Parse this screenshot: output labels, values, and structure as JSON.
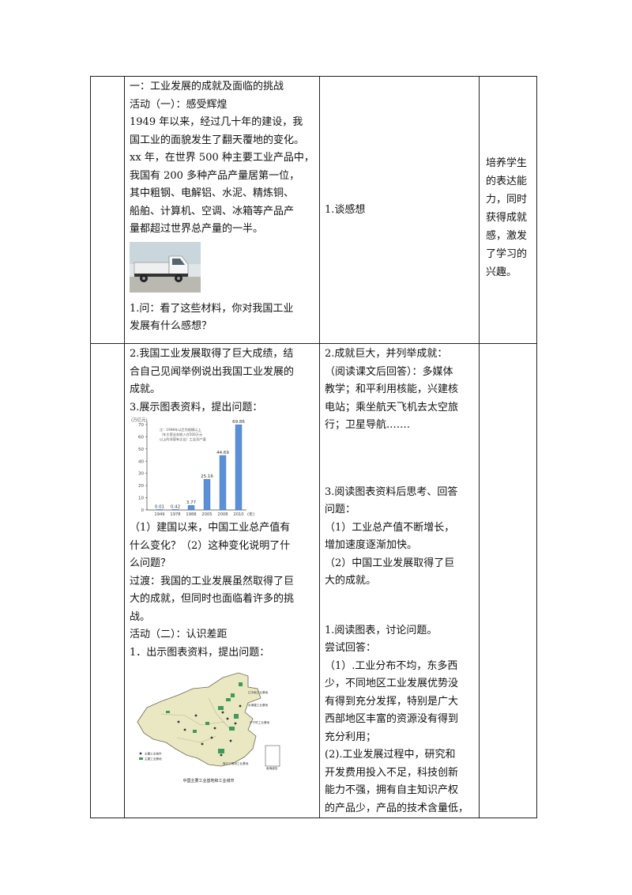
{
  "row1": {
    "col2": [
      "一：工业发展的成就及面临的挑战",
      "活动（一）：感受辉煌",
      "1949 年以来，经过几十年的建设，我",
      "国工业的面貌发生了翻天覆地的变化。",
      "xx 年，在世界 500 种主要工业产品中，",
      "我国有 200 多种产品产量居第一位，",
      "其中粗钢、电解铝、水泥、精炼铜、",
      "船舶、计算机、空调、冰箱等产品产",
      "量都超过世界总产量的一半。"
    ],
    "question": [
      "1.问：看了这些材料，你对我国工业",
      "发展有什么感想？"
    ],
    "student": "1.谈感想",
    "purpose": [
      "培养学生",
      "的表达能",
      "力，同时",
      "获得成就",
      "感，激发",
      "了学习的",
      "兴趣。"
    ]
  },
  "row2": {
    "col2_a": [
      "2.我国工业发展取得了巨大成绩，结",
      "合自己见闻举例说出我国工业发展的",
      "成就。",
      "3.展示图表资料，提出问题："
    ],
    "col2_b": [
      "（1）建国以来，中国工业总产值有",
      "什么变化？（2）这种变化说明了什",
      "么问题？",
      "过渡：我国的工业发展虽然取得了巨",
      "大的成就，但同时也面临着许多的挑",
      "战。",
      "活动（二）：认识差距",
      "1．出示图表资料，提出问题："
    ],
    "col3_a": [
      "2.成就巨大，并列举成就：",
      "（阅读课文后回答）：多媒体",
      "教学；和平利用核能，兴建核",
      "电站；乘坐航天飞机去太空旅",
      "行；卫星导航.……"
    ],
    "col3_b": [
      "3.阅读图表资料后思考、回答",
      "问题：",
      "（1）工业总产值不断增长，",
      "增加速度逐渐加快。",
      "（2）中国工业发展取得了巨",
      "大的成就。"
    ],
    "col3_c": [
      "1.阅读图表，讨论问题。",
      "尝试回答：",
      "（1）.工业分布不均，东多西",
      "少，不同地区工业发展优势没",
      "有得到充分发挥，特别是广大",
      "西部地区丰富的资源没有得到",
      "充分利用；",
      "(2).工业发展过程中，研究和",
      "开发费用投入不足，科技创新",
      "能力不强，拥有自主知识产权",
      "的产品少，产品的技术含量低，"
    ]
  },
  "chart_data": {
    "type": "bar",
    "categories": [
      "1949",
      "1978",
      "1988",
      "2005",
      "2008",
      "2010"
    ],
    "values": [
      0.01,
      0.42,
      3.77,
      25.16,
      44.69,
      69.86
    ],
    "value_labels": [
      "0.01",
      "0.42",
      "3.77",
      "25.16",
      "44.69",
      "69.86"
    ],
    "ylabel": "(万亿元)",
    "xunit": "(年)",
    "note": [
      "注：1998年以后为规模以上",
      "（年主营业务收入在500万元",
      "以上的非国有企业）工业总产值"
    ],
    "yticks": [
      0,
      10,
      20,
      30,
      40,
      50,
      60,
      70
    ],
    "ylim": [
      0,
      70
    ],
    "bar_color": "#5b8fd8"
  },
  "map": {
    "caption": "中国主要工业基地和工业城市",
    "legend": [
      "主要工业城市",
      "主要工业基地"
    ],
    "region_labels": [
      "辽中南工业基地",
      "京津唐工业基地",
      "沪宁杭工业基地",
      "珠江三角洲工业基地",
      "南海诸岛"
    ]
  }
}
